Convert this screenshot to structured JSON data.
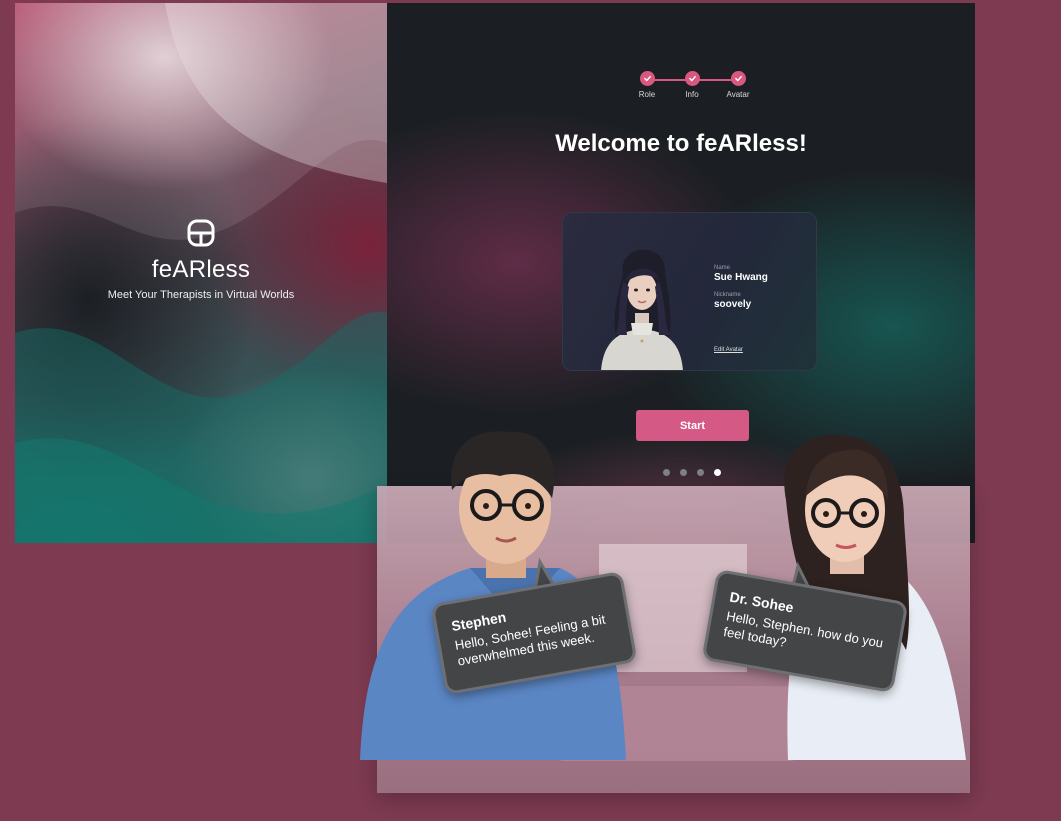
{
  "brand": {
    "name": "feARless",
    "tagline": "Meet Your Therapists in Virtual Worlds"
  },
  "stepper": {
    "steps": [
      {
        "label": "Role",
        "completed": true
      },
      {
        "label": "Info",
        "completed": true
      },
      {
        "label": "Avatar",
        "completed": true
      }
    ]
  },
  "welcome": {
    "title": "Welcome to feARless!"
  },
  "profile": {
    "name_label": "Name",
    "name_value": "Sue Hwang",
    "nickname_label": "Nickname",
    "nickname_value": "soovely",
    "edit_link": "Edit Avatar"
  },
  "actions": {
    "start_label": "Start"
  },
  "pager": {
    "total": 4,
    "active_index": 3
  },
  "chat": {
    "left": {
      "speaker": "Stephen",
      "message": "Hello, Sohee! Feeling a bit overwhelmed this week."
    },
    "right": {
      "speaker": "Dr. Sohee",
      "message": "Hello, Stephen. how do you feel today?"
    }
  },
  "colors": {
    "accent": "#d45a85",
    "step_accent": "#d9587f",
    "background": "#7d3a50",
    "panel_dark": "#1b1f23",
    "bubble": "#444547"
  }
}
